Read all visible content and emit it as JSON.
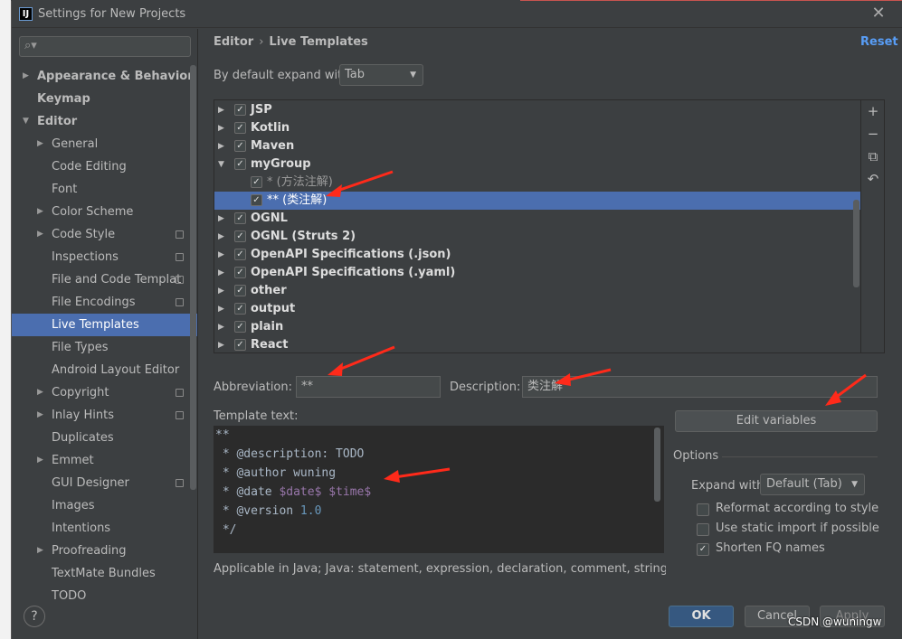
{
  "window": {
    "title": "Settings for New Projects",
    "app_icon": "IJ",
    "close_icon": "close-icon"
  },
  "sidebar": {
    "search_placeholder": "",
    "items": [
      {
        "label": "Appearance & Behavior",
        "arrow": "▶",
        "bold": true
      },
      {
        "label": "Keymap",
        "arrow": "",
        "bold": true
      },
      {
        "label": "Editor",
        "arrow": "▼",
        "bold": true
      },
      {
        "label": "General",
        "arrow": "▶"
      },
      {
        "label": "Code Editing",
        "arrow": ""
      },
      {
        "label": "Font",
        "arrow": ""
      },
      {
        "label": "Color Scheme",
        "arrow": "▶"
      },
      {
        "label": "Code Style",
        "arrow": "▶",
        "badge": true
      },
      {
        "label": "Inspections",
        "arrow": "",
        "badge": true
      },
      {
        "label": "File and Code Templat",
        "arrow": "",
        "badge": true
      },
      {
        "label": "File Encodings",
        "arrow": "",
        "badge": true
      },
      {
        "label": "Live Templates",
        "arrow": "",
        "selected": true
      },
      {
        "label": "File Types",
        "arrow": ""
      },
      {
        "label": "Android Layout Editor",
        "arrow": ""
      },
      {
        "label": "Copyright",
        "arrow": "▶",
        "badge": true
      },
      {
        "label": "Inlay Hints",
        "arrow": "▶",
        "badge": true
      },
      {
        "label": "Duplicates",
        "arrow": ""
      },
      {
        "label": "Emmet",
        "arrow": "▶"
      },
      {
        "label": "GUI Designer",
        "arrow": "",
        "badge": true
      },
      {
        "label": "Images",
        "arrow": ""
      },
      {
        "label": "Intentions",
        "arrow": ""
      },
      {
        "label": "Proofreading",
        "arrow": "▶"
      },
      {
        "label": "TextMate Bundles",
        "arrow": ""
      },
      {
        "label": "TODO",
        "arrow": ""
      }
    ],
    "help_label": "?"
  },
  "main": {
    "breadcrumb": [
      "Editor",
      "Live Templates"
    ],
    "breadcrumb_sep": "›",
    "reset_label": "Reset",
    "expand_label": "By default expand with",
    "expand_value": "Tab",
    "templates": [
      {
        "name": "JSP",
        "arrow": "▶",
        "checked": true
      },
      {
        "name": "Kotlin",
        "arrow": "▶",
        "checked": true
      },
      {
        "name": "Maven",
        "arrow": "▶",
        "checked": true
      },
      {
        "name": "myGroup",
        "arrow": "▼",
        "checked": true
      },
      {
        "name": "* (方法注解)",
        "arrow": "",
        "checked": true,
        "child": true
      },
      {
        "name": "** (类注解)",
        "arrow": "",
        "checked": true,
        "child": true,
        "selected": true
      },
      {
        "name": "OGNL",
        "arrow": "▶",
        "checked": true
      },
      {
        "name": "OGNL (Struts 2)",
        "arrow": "▶",
        "checked": true
      },
      {
        "name": "OpenAPI Specifications (.json)",
        "arrow": "▶",
        "checked": true
      },
      {
        "name": "OpenAPI Specifications (.yaml)",
        "arrow": "▶",
        "checked": true
      },
      {
        "name": "other",
        "arrow": "▶",
        "checked": true
      },
      {
        "name": "output",
        "arrow": "▶",
        "checked": true
      },
      {
        "name": "plain",
        "arrow": "▶",
        "checked": true
      },
      {
        "name": "React",
        "arrow": "▶",
        "checked": true
      }
    ],
    "toolbar": {
      "add": "+",
      "remove": "−",
      "copy": "⧉",
      "restore": "↶"
    },
    "abbreviation_label": "Abbreviation:",
    "abbreviation_value": "**",
    "description_label": "Description:",
    "description_value": "类注解",
    "template_text_label": "Template text:",
    "template_lines": [
      {
        "text": "**"
      },
      {
        "text": " * @description: TODO"
      },
      {
        "text": " * @author wuning"
      },
      {
        "prefix": " * @date ",
        "var1": "$date$",
        "mid": " ",
        "var2": "$time$"
      },
      {
        "prefix": " * @version ",
        "num": "1.0"
      },
      {
        "text": " */"
      }
    ],
    "edit_variables_label": "Edit variables",
    "options_label": "Options",
    "expand_with_label": "Expand with",
    "expand_with_value": "Default (Tab)",
    "options": [
      {
        "label": "Reformat according to style",
        "checked": false
      },
      {
        "label": "Use static import if possible",
        "checked": false
      },
      {
        "label": "Shorten FQ names",
        "checked": true
      }
    ],
    "applicable_text": "Applicable in Java; Java: statement, expression, declaration, comment, string, smart ty"
  },
  "footer": {
    "ok_label": "OK",
    "cancel_label": "Cancel",
    "apply_label": "Apply"
  },
  "watermark": "CSDN @wuningw",
  "colors": {
    "accent": "#4b6eaf",
    "link": "#589df6",
    "annotation_arrow": "#ff2a1a"
  }
}
